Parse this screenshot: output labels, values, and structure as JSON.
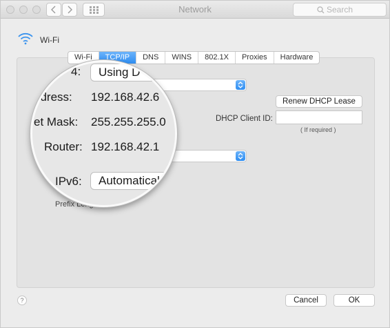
{
  "window": {
    "title": "Network"
  },
  "search": {
    "placeholder": "Search"
  },
  "interface": {
    "name": "Wi-Fi"
  },
  "tabs": [
    "Wi-Fi",
    "TCP/IP",
    "DNS",
    "WINS",
    "802.1X",
    "Proxies",
    "Hardware"
  ],
  "active_tab": "TCP/IP",
  "buttons": {
    "renew_dhcp": "Renew DHCP Lease",
    "cancel": "Cancel",
    "ok": "OK"
  },
  "dhcp": {
    "client_id_label": "DHCP Client ID:",
    "client_id_hint": "( If required )",
    "client_id_value": ""
  },
  "background_labels": {
    "prefix_length": "Prefix Lengt"
  },
  "magnifier": {
    "configure_ipv4_label": "4:",
    "configure_ipv4_value": "Using D",
    "ip_address_label": "ddress:",
    "ip_address_value": "192.168.42.6",
    "subnet_mask_label": "et Mask:",
    "subnet_mask_value": "255.255.255.0",
    "router_label": "Router:",
    "router_value": "192.168.42.1",
    "configure_ipv6_label": "IPv6:",
    "configure_ipv6_value": "Automatical"
  },
  "help": {
    "label": "?"
  },
  "colors": {
    "accent": "#2f8ef2",
    "window_bg": "#ececec",
    "panel_bg": "#e3e3e3"
  }
}
